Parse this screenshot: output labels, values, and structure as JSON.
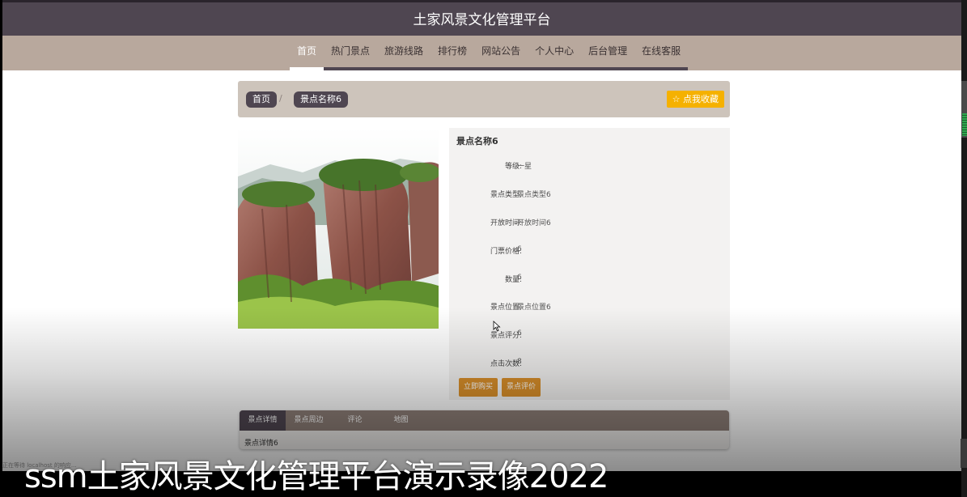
{
  "site": {
    "title": "土家风景文化管理平台"
  },
  "nav": {
    "items": [
      {
        "label": "首页",
        "active": true
      },
      {
        "label": "热门景点"
      },
      {
        "label": "旅游线路"
      },
      {
        "label": "排行榜"
      },
      {
        "label": "网站公告"
      },
      {
        "label": "个人中心"
      },
      {
        "label": "后台管理"
      },
      {
        "label": "在线客服"
      }
    ]
  },
  "breadcrumb": {
    "home": "首页",
    "separator": "/",
    "current": "景点名称6"
  },
  "favorite_button": "☆ 点我收藏",
  "detail": {
    "name": "景点名称6",
    "fields": [
      {
        "label": "等级:",
        "value": "一星"
      },
      {
        "label": "景点类型:",
        "value": "景点类型6"
      },
      {
        "label": "开放时间:",
        "value": "开放时间6"
      },
      {
        "label": "门票价格:",
        "value": "6"
      },
      {
        "label": "数量:",
        "value": "6"
      },
      {
        "label": "景点位置:",
        "value": "景点位置6"
      },
      {
        "label": "景点评分:",
        "value": "6"
      },
      {
        "label": "点击次数:",
        "value": "8"
      }
    ],
    "buy_button": "立即购买",
    "review_button": "景点评价"
  },
  "tabs": {
    "items": [
      {
        "label": "景点详情",
        "active": true
      },
      {
        "label": "景点周边"
      },
      {
        "label": "评论"
      },
      {
        "label": "地图"
      }
    ],
    "content": "景点详情6"
  },
  "status_text": "正在等待 localhost 的响应...",
  "video_caption": "ssm土家风景文化管理平台演示录像2022",
  "colors": {
    "header": "#4f4651",
    "nav": "#b8a89d",
    "favorite": "#f5b100",
    "action": "#d98f2a"
  }
}
